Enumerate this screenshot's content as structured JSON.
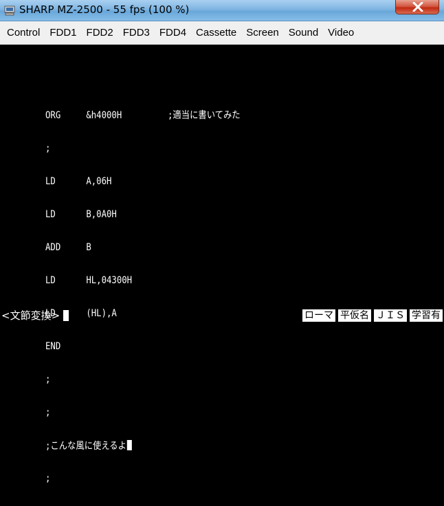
{
  "window": {
    "title": "SHARP MZ-2500 - 55 fps (100 %)"
  },
  "menu": {
    "items": [
      "Control",
      "FDD1",
      "FDD2",
      "FDD3",
      "FDD4",
      "Cassette",
      "Screen",
      "Sound",
      "Video"
    ]
  },
  "screen": {
    "lines": [
      "ORG     &h4000H         ;適当に書いてみた",
      ";",
      "LD      A,06H",
      "LD      B,0A0H",
      "ADD     B",
      "LD      HL,04300H",
      "LD      (HL),A",
      "END",
      ";",
      ";",
      ";こんな風に使えるよ",
      ";"
    ]
  },
  "ime": {
    "mode_label": "<文節変換>",
    "badges": [
      "ローマ",
      "平仮名",
      "ＪＩＳ",
      "学習有"
    ]
  }
}
